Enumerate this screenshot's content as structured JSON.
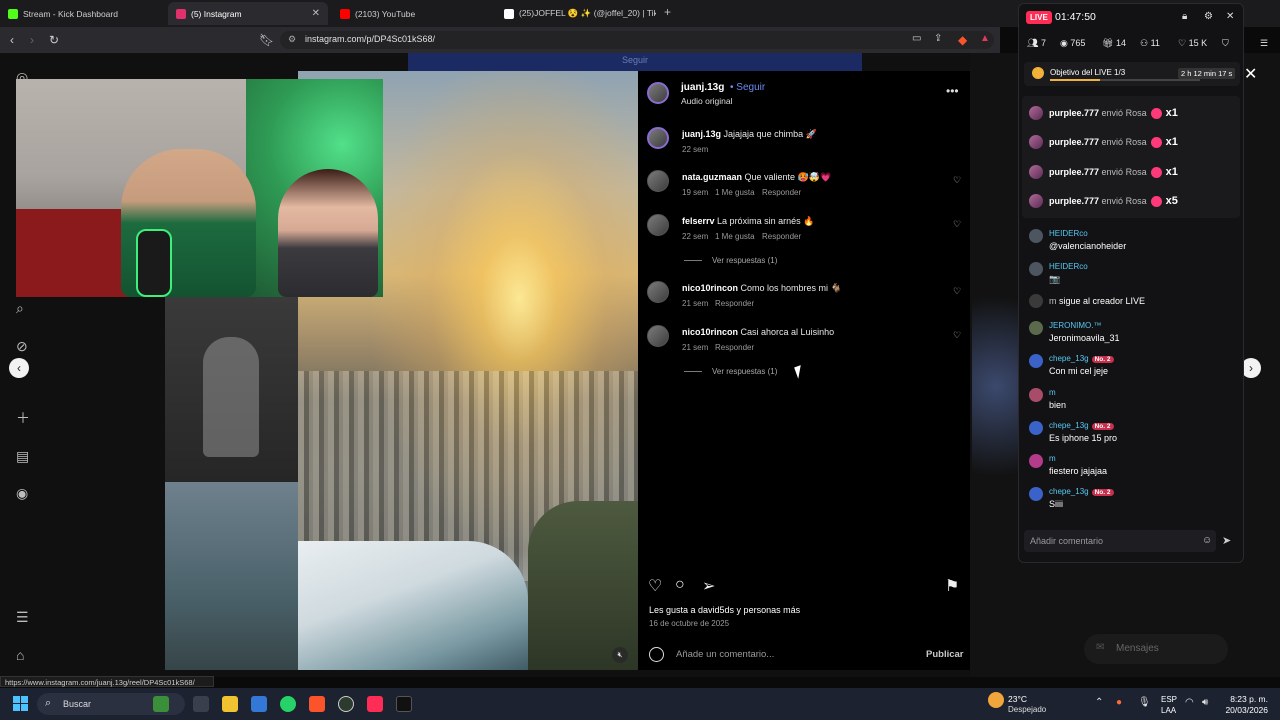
{
  "browser": {
    "tabs": [
      {
        "title": "Stream - Kick Dashboard",
        "favicon_color": "#53fc18",
        "active": false
      },
      {
        "title": "(5) Instagram",
        "favicon_color": "#e1306c",
        "active": true
      },
      {
        "title": "(2103) YouTube",
        "favicon_color": "#ff0000",
        "active": false
      },
      {
        "title": "(25)JOFFEL 😵 ✨ (@joffel_20) | TikTok",
        "favicon_color": "#ffffff",
        "active": false
      }
    ],
    "new_tab": "+",
    "url": "instagram.com/p/DP4Sc01kS68/",
    "status_url": "https://www.instagram.com/juanj.13g/reel/DP4Sc01kS68/"
  },
  "page": {
    "top_banner": "Seguir"
  },
  "post": {
    "username": "juanj.13g",
    "follow": "Seguir",
    "audio": "Audio original",
    "comments": [
      {
        "user": "juanj.13g",
        "text": "Jajajaja que chimba 🚀",
        "meta": "22 sem",
        "likes": "",
        "reply": "",
        "has_heart": false
      },
      {
        "user": "nata.guzmaan",
        "text": "Que valiente 🥵🤯💗",
        "meta": "19 sem",
        "likes": "1 Me gusta",
        "reply": "Responder",
        "has_heart": true
      },
      {
        "user": "felserrv",
        "text": "La próxima sin arnés 🔥",
        "meta": "22 sem",
        "likes": "1 Me gusta",
        "reply": "Responder",
        "has_heart": true,
        "replies": "Ver respuestas (1)"
      },
      {
        "user": "nico10rincon",
        "text": "Como los hombres mi 🐐",
        "meta": "21 sem",
        "likes": "",
        "reply": "Responder",
        "has_heart": true
      },
      {
        "user": "nico10rincon",
        "text": "Casi ahorca al Luisinho",
        "meta": "21 sem",
        "likes": "",
        "reply": "Responder",
        "has_heart": true,
        "replies": "Ver respuestas (1)"
      }
    ],
    "likes_text": "Les gusta a david5ds y personas más",
    "date": "16 de octubre de 2025",
    "add_comment_placeholder": "Añade un comentario...",
    "publish": "Publicar"
  },
  "live": {
    "badge": "LIVE",
    "timer": "01:47:50",
    "stats": {
      "users": "7",
      "viewers": "765",
      "gifts": "14",
      "members": "11",
      "likes": "15 K"
    },
    "goal": {
      "label": "Objetivo del LIVE",
      "progress_text": "1/3",
      "progress_fraction": 0.333,
      "time_left": "2 h 12 min 17 s"
    },
    "gifts": [
      {
        "from": "purplee.777",
        "verb": "envió Rosa",
        "count": "x1"
      },
      {
        "from": "purplee.777",
        "verb": "envió Rosa",
        "count": "x1"
      },
      {
        "from": "purplee.777",
        "verb": "envió Rosa",
        "count": "x1"
      },
      {
        "from": "purplee.777",
        "verb": "envió Rosa",
        "count": "x5"
      }
    ],
    "chat": [
      {
        "user": "HEIDERco",
        "badge": "",
        "message": "@valencianoheider"
      },
      {
        "user": "HEIDERco",
        "badge": "",
        "message": "📷"
      },
      {
        "user": "m",
        "badge": "",
        "message": "sigue al creador LIVE",
        "inline": true
      },
      {
        "user": "JERONIMO.™",
        "badge": "",
        "message": "Jeronimoavila_31"
      },
      {
        "user": "chepe_13g",
        "badge": "No. 2",
        "message": "Con mi cel jeje"
      },
      {
        "user": "m",
        "badge": "",
        "message": "bien"
      },
      {
        "user": "chepe_13g",
        "badge": "No. 2",
        "message": "Es iphone 15 pro"
      },
      {
        "user": "m",
        "badge": "",
        "message": "fiestero jajajaa"
      },
      {
        "user": "chepe_13g",
        "badge": "No. 2",
        "message": "Siiii"
      }
    ],
    "comment_placeholder": "Añadir comentario",
    "messages_label": "Mensajes"
  },
  "taskbar": {
    "search": "Buscar",
    "weather_temp": "23°C",
    "weather_desc": "Despejado",
    "lang_1": "ESP",
    "lang_2": "LAA",
    "time": "8:23 p. m.",
    "date": "20/03/2026"
  },
  "colors": {
    "accent_blue": "#6c8bf5",
    "live_red": "#ff2d55",
    "chat_user": "#58c8f2",
    "gift_rose": "#ff3a7a"
  }
}
